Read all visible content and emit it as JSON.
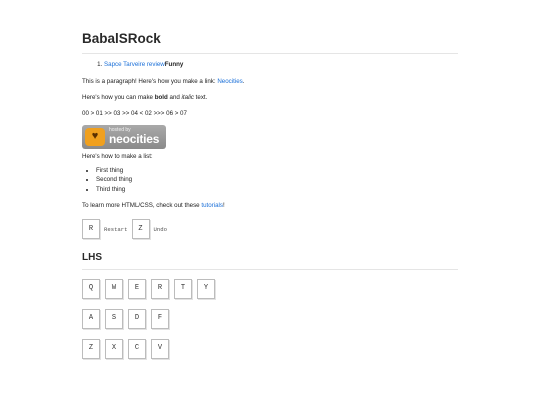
{
  "page": {
    "title": "BabalSRock",
    "list_item": {
      "link": "Sapce Tarveire review",
      "bold": "Funny"
    },
    "para1": {
      "text": "This is a paragraph! Here's how you make a link: ",
      "link": "Neocities",
      "suffix": "."
    },
    "para2": {
      "prefix": "Here's how you can make ",
      "bold": "bold",
      "middle": " and ",
      "italic": "italic",
      "suffix": " text."
    },
    "sequence": "00 > 01 >> 03 >> 04 < 02 >>> 06 > 07",
    "badge": {
      "small": "hosted by",
      "big": "neocities",
      "icon": "cat-icon"
    },
    "list_intro": "Here's how to make a list:",
    "list_items": [
      "First thing",
      "Second thing",
      "Third thing"
    ],
    "learn": {
      "text": "To learn more HTML/CSS, check out these ",
      "link": "tutorials",
      "suffix": "!"
    },
    "controls": {
      "restart_key": "R",
      "restart_label": "Restart",
      "undo_key": "Z",
      "undo_label": "Undo"
    },
    "section_title": "LHS",
    "keyboard": {
      "row1": [
        "Q",
        "W",
        "E",
        "R",
        "T",
        "Y"
      ],
      "row2": [
        "A",
        "S",
        "D",
        "F"
      ],
      "row3": [
        "Z",
        "X",
        "C",
        "V"
      ]
    },
    "colors": {
      "link": "#1a6fd8",
      "text": "#222222"
    }
  }
}
